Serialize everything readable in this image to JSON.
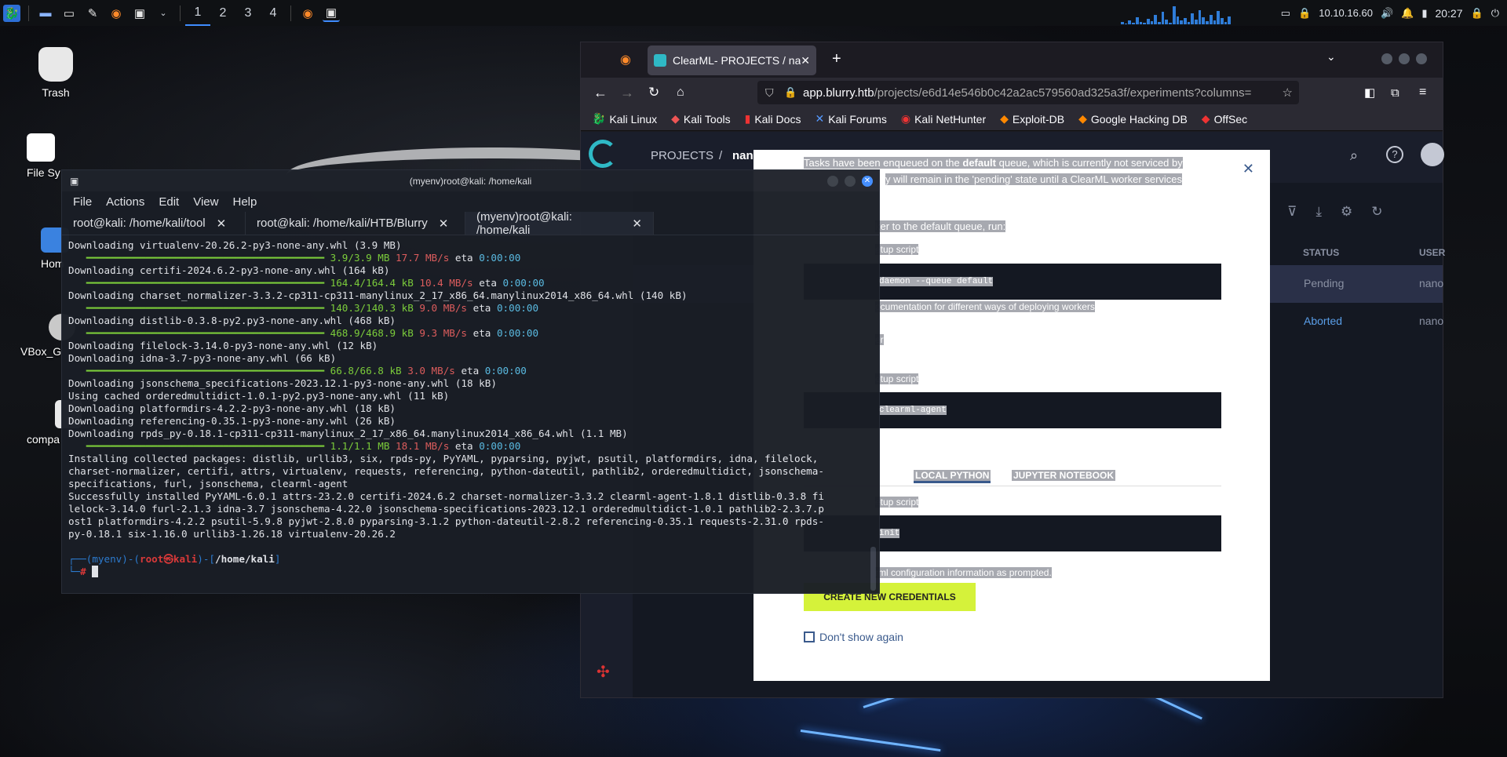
{
  "taskbar": {
    "workspaces": [
      "1",
      "2",
      "3",
      "4"
    ],
    "active_workspace": "1",
    "ip": "10.10.16.60",
    "clock": "20:27"
  },
  "desktop": {
    "icons": [
      "Trash",
      "File Sy",
      "Hom",
      "VBox_G",
      "compa"
    ]
  },
  "browser": {
    "tab_title": "ClearML- PROJECTS / nan",
    "url_host": "app.blurry.htb",
    "url_path": "/projects/e6d14e546b0c42a2ac579560ad325a3f/experiments?columns=",
    "bookmarks": [
      "Kali Linux",
      "Kali Tools",
      "Kali Docs",
      "Kali Forums",
      "Kali NetHunter",
      "Exploit-DB",
      "Google Hacking DB",
      "OffSec"
    ],
    "app": {
      "breadcrumb_root": "PROJECTS",
      "breadcrumb_sep": "/",
      "breadcrumb_project": "nano",
      "col_status": "STATUS",
      "col_user": "USER",
      "rows": [
        {
          "status": "Pending",
          "user": "nano"
        },
        {
          "status": "Aborted",
          "user": "nano"
        }
      ]
    },
    "modal": {
      "line1_pre": "Tasks have been enqueued on the ",
      "line1_bold": "default",
      "line1_post": " queue, which is currently not serviced by",
      "line2": "y will remain in the 'pending' state until a ClearML worker services",
      "line3": "ker to the default queue, run:",
      "setup1": "etup script",
      "code1": "daemon --queue default",
      "doc_link": "ocumentation for different ways of deploying workers",
      "mid_label": "er",
      "setup2": "etup script",
      "code2": "clearml-agent",
      "tab_local": "LOCAL PYTHON",
      "tab_jupyter": "JUPYTER NOTEBOOK",
      "setup3": "etup script",
      "code3": "init",
      "config_text": "rml configuration information as prompted.",
      "create_btn": "CREATE NEW CREDENTIALS",
      "dont_show": "Don't show again"
    }
  },
  "terminal": {
    "title": "(myenv)root@kali: /home/kali",
    "menu": [
      "File",
      "Actions",
      "Edit",
      "View",
      "Help"
    ],
    "tabs": [
      "root@kali: /home/kali/tool",
      "root@kali: /home/kali/HTB/Blurry",
      "(myenv)root@kali: /home/kali"
    ],
    "lines": [
      {
        "t": "Downloading virtualenv-20.26.2-py3-none-any.whl (3.9 MB)"
      },
      {
        "p": "3.9/3.9 MB",
        "s": "17.7 MB/s",
        "e": "0:00:00"
      },
      {
        "t": "Downloading certifi-2024.6.2-py3-none-any.whl (164 kB)"
      },
      {
        "p": "164.4/164.4 kB",
        "s": "10.4 MB/s",
        "e": "0:00:00"
      },
      {
        "t": "Downloading charset_normalizer-3.3.2-cp311-cp311-manylinux_2_17_x86_64.manylinux2014_x86_64.whl (140 kB)"
      },
      {
        "p": "140.3/140.3 kB",
        "s": "9.0 MB/s",
        "e": "0:00:00"
      },
      {
        "t": "Downloading distlib-0.3.8-py2.py3-none-any.whl (468 kB)"
      },
      {
        "p": "468.9/468.9 kB",
        "s": "9.3 MB/s",
        "e": "0:00:00"
      },
      {
        "t": "Downloading filelock-3.14.0-py3-none-any.whl (12 kB)"
      },
      {
        "t": "Downloading idna-3.7-py3-none-any.whl (66 kB)"
      },
      {
        "p": "66.8/66.8 kB",
        "s": "3.0 MB/s",
        "e": "0:00:00"
      },
      {
        "t": "Downloading jsonschema_specifications-2023.12.1-py3-none-any.whl (18 kB)"
      },
      {
        "t": "Using cached orderedmultidict-1.0.1-py2.py3-none-any.whl (11 kB)"
      },
      {
        "t": "Downloading platformdirs-4.2.2-py3-none-any.whl (18 kB)"
      },
      {
        "t": "Downloading referencing-0.35.1-py3-none-any.whl (26 kB)"
      },
      {
        "t": "Downloading rpds_py-0.18.1-cp311-cp311-manylinux_2_17_x86_64.manylinux2014_x86_64.whl (1.1 MB)"
      },
      {
        "p": "1.1/1.1 MB",
        "s": "18.1 MB/s",
        "e": "0:00:00"
      },
      {
        "t": "Installing collected packages: distlib, urllib3, six, rpds-py, PyYAML, pyparsing, pyjwt, psutil, platformdirs, idna, filelock,"
      },
      {
        "t": "charset-normalizer, certifi, attrs, virtualenv, requests, referencing, python-dateutil, pathlib2, orderedmultidict, jsonschema-"
      },
      {
        "t": "specifications, furl, jsonschema, clearml-agent"
      },
      {
        "t": "Successfully installed PyYAML-6.0.1 attrs-23.2.0 certifi-2024.6.2 charset-normalizer-3.3.2 clearml-agent-1.8.1 distlib-0.3.8 fi"
      },
      {
        "t": "lelock-3.14.0 furl-2.1.3 idna-3.7 jsonschema-4.22.0 jsonschema-specifications-2023.12.1 orderedmultidict-1.0.1 pathlib2-2.3.7.p"
      },
      {
        "t": "ost1 platformdirs-4.2.2 psutil-5.9.8 pyjwt-2.8.0 pyparsing-3.1.2 python-dateutil-2.8.2 referencing-0.35.1 requests-2.31.0 rpds-"
      },
      {
        "t": "py-0.18.1 six-1.16.0 urllib3-1.26.18 virtualenv-20.26.2"
      }
    ],
    "prompt": {
      "env": "(myenv)",
      "user": "root㉿kali",
      "path": "/home/kali",
      "symbol": "#"
    },
    "eta_label": "eta"
  },
  "colors": {
    "accent": "#3f8cff",
    "terminal_bg": "#1a1e26",
    "progress": "#7fd23c",
    "speed": "#e35f5f",
    "clearml_green": "#d5f23a"
  }
}
